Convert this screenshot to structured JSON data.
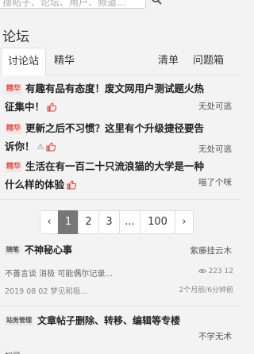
{
  "search": {
    "placeholder": "搜帖子、论坛、用户、频道..."
  },
  "page": {
    "title": "论坛"
  },
  "tabs": {
    "forum": "讨论站",
    "featured": "精华",
    "list": "清单",
    "questions": "问题箱"
  },
  "topics": [
    {
      "badge": "精华",
      "line1": "有趣有品有态度！废文网用户测试题火热",
      "line2": "征集中！",
      "author": "无处可逃"
    },
    {
      "badge": "精华",
      "line1": "更新之后不习惯？这里有个升级捷径要告",
      "line2": "诉你！",
      "warn": "⚠",
      "author": "无处可逃"
    },
    {
      "badge": "精华",
      "line1": "生活在有一百二十只流浪猫的大学是一种",
      "line2": "什么样的体验",
      "author": "喵了个咪"
    }
  ],
  "pager": {
    "prev": "‹",
    "pages": [
      "1",
      "2",
      "3",
      "...",
      "100"
    ],
    "next": "›"
  },
  "cards": [
    {
      "badge": "随笔",
      "title": "不神秘心事",
      "user": "紫藤挂云木",
      "excerpt": "不善言谈 消极 可能偶尔记录...",
      "date": "2019 08 02 梦见和极...",
      "stats": "223 12",
      "ago": "2个月前/6分钟前"
    },
    {
      "badge": "站务管理",
      "title": "文章帖子删除、转移、编辑等专楼",
      "user": "不学无术",
      "excerpt": "",
      "date": "",
      "stats": "",
      "ago": ""
    }
  ],
  "partial": {
    "line": "如题"
  },
  "colors": {
    "thumb": "#e0413b",
    "page_current": "#777777",
    "badge_featured": "#d9534f"
  }
}
